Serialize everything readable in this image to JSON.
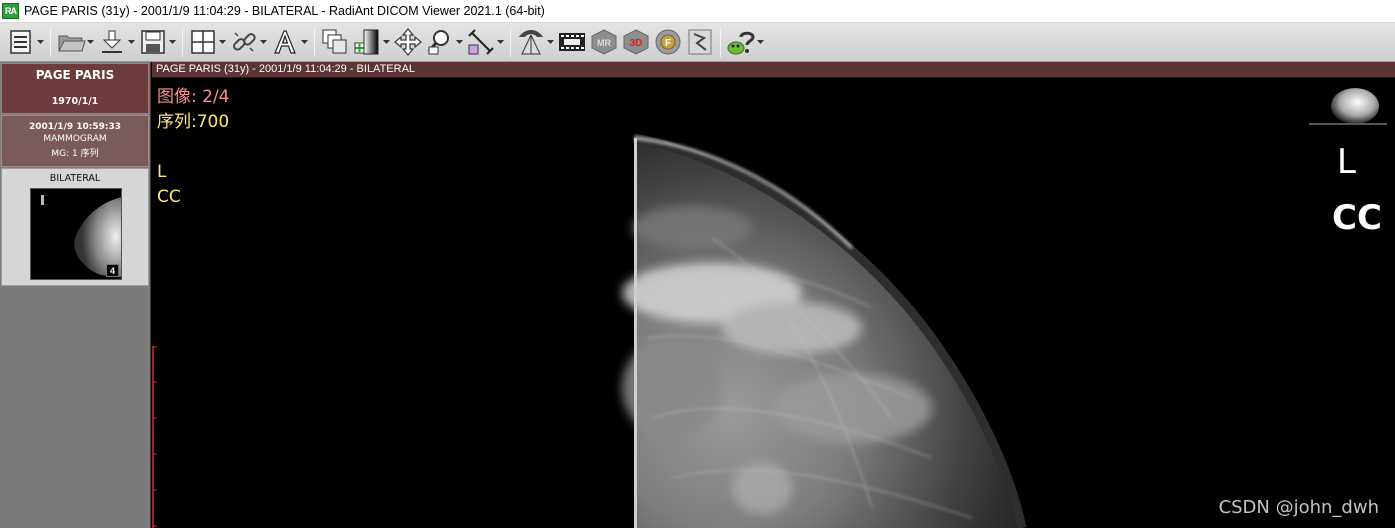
{
  "window": {
    "app_icon": "RA",
    "title": "PAGE PARIS (31y) - 2001/1/9 11:04:29 - BILATERAL - RadiAnt DICOM Viewer 2021.1 (64-bit)"
  },
  "toolbar": {
    "buttons": [
      {
        "icon": "study-browser-icon",
        "dropdown": true
      },
      {
        "icon": "open-folder-icon",
        "dropdown": true
      },
      {
        "icon": "download-icon",
        "dropdown": true
      },
      {
        "icon": "save-icon",
        "dropdown": true
      },
      {
        "icon": "layout-grid-icon",
        "dropdown": true
      },
      {
        "icon": "sync-link-icon",
        "dropdown": true
      },
      {
        "icon": "annotation-text-icon",
        "dropdown": true
      },
      {
        "icon": "series-stack-icon",
        "dropdown": false
      },
      {
        "icon": "window-level-icon",
        "dropdown": true
      },
      {
        "icon": "pan-icon",
        "dropdown": false
      },
      {
        "icon": "zoom-icon",
        "dropdown": true
      },
      {
        "icon": "measure-icon",
        "dropdown": true
      },
      {
        "icon": "fusion-cone-icon",
        "dropdown": true
      },
      {
        "icon": "cine-icon",
        "dropdown": false
      },
      {
        "icon": "mpr-icon",
        "dropdown": false
      },
      {
        "icon": "3d-icon",
        "dropdown": false
      },
      {
        "icon": "fusion-f-icon",
        "dropdown": false
      },
      {
        "icon": "export-icon",
        "dropdown": false
      },
      {
        "icon": "help-icon",
        "dropdown": true
      }
    ]
  },
  "sidebar": {
    "study": {
      "patient_name": "PAGE PARIS",
      "birth_date": "1970/1/1"
    },
    "series": {
      "datetime": "2001/1/9 10:59:33",
      "description": "MAMMOGRAM",
      "modality_count": "MG: 1 序列"
    },
    "thumbnail": {
      "label": "BILATERAL",
      "image_count": "4"
    }
  },
  "viewport": {
    "header": "PAGE PARIS (31y) - 2001/1/9 11:04:29 - BILATERAL",
    "overlay": {
      "image_label": "图像: 2/4",
      "series_label": "序列:700",
      "laterality": "L",
      "view": "CC"
    },
    "orientation_laterality": "L",
    "orientation_view": "CC"
  },
  "watermark": "CSDN @john_dwh",
  "colors": {
    "study_card": "#6d3b3b",
    "viewport_header": "#5d3434",
    "overlay_red": "#ff8b8b",
    "overlay_yellow": "#ffe67a"
  }
}
